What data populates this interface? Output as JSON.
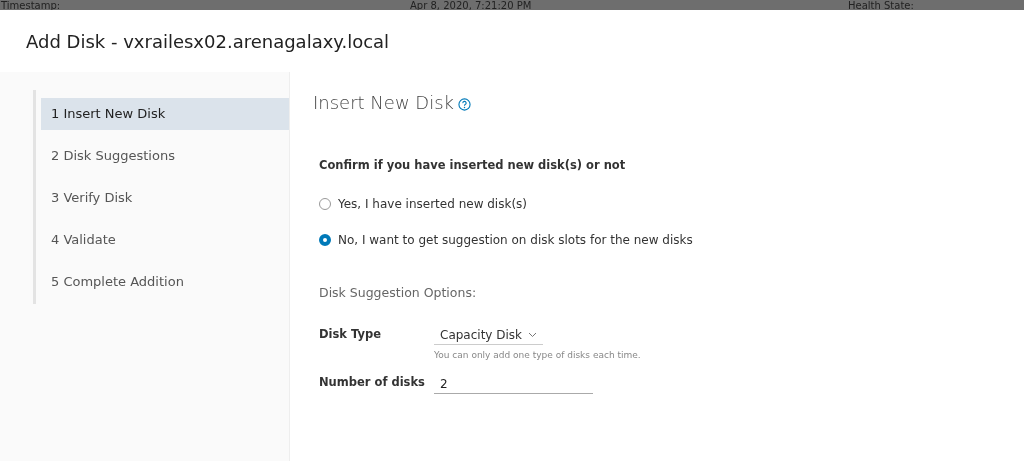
{
  "background_bar": {
    "label_1": "Timestamp:",
    "value_1": "Apr 8, 2020, 7:21:20 PM",
    "label_2": "Health State:"
  },
  "window": {
    "title": "Add Disk - vxrailesx02.arenagalaxy.local"
  },
  "steps": [
    {
      "label": "1 Insert New Disk",
      "selected": true
    },
    {
      "label": "2 Disk Suggestions",
      "selected": false
    },
    {
      "label": "3 Verify Disk",
      "selected": false
    },
    {
      "label": "4 Validate",
      "selected": false
    },
    {
      "label": "5 Complete Addition",
      "selected": false
    }
  ],
  "page": {
    "title": "Insert New Disk",
    "question": "Confirm if you have inserted new disk(s) or not",
    "options": [
      {
        "label": "Yes, I have inserted new disk(s)",
        "selected": false
      },
      {
        "label": "No, I want to get suggestion on disk slots for the new disks",
        "selected": true
      }
    ],
    "section": "Disk Suggestion Options:",
    "disk_type": {
      "label": "Disk Type",
      "value": "Capacity Disk",
      "hint": "You can only add one type of disks each time."
    },
    "number_of_disks": {
      "label": "Number of disks",
      "value": "2"
    }
  }
}
